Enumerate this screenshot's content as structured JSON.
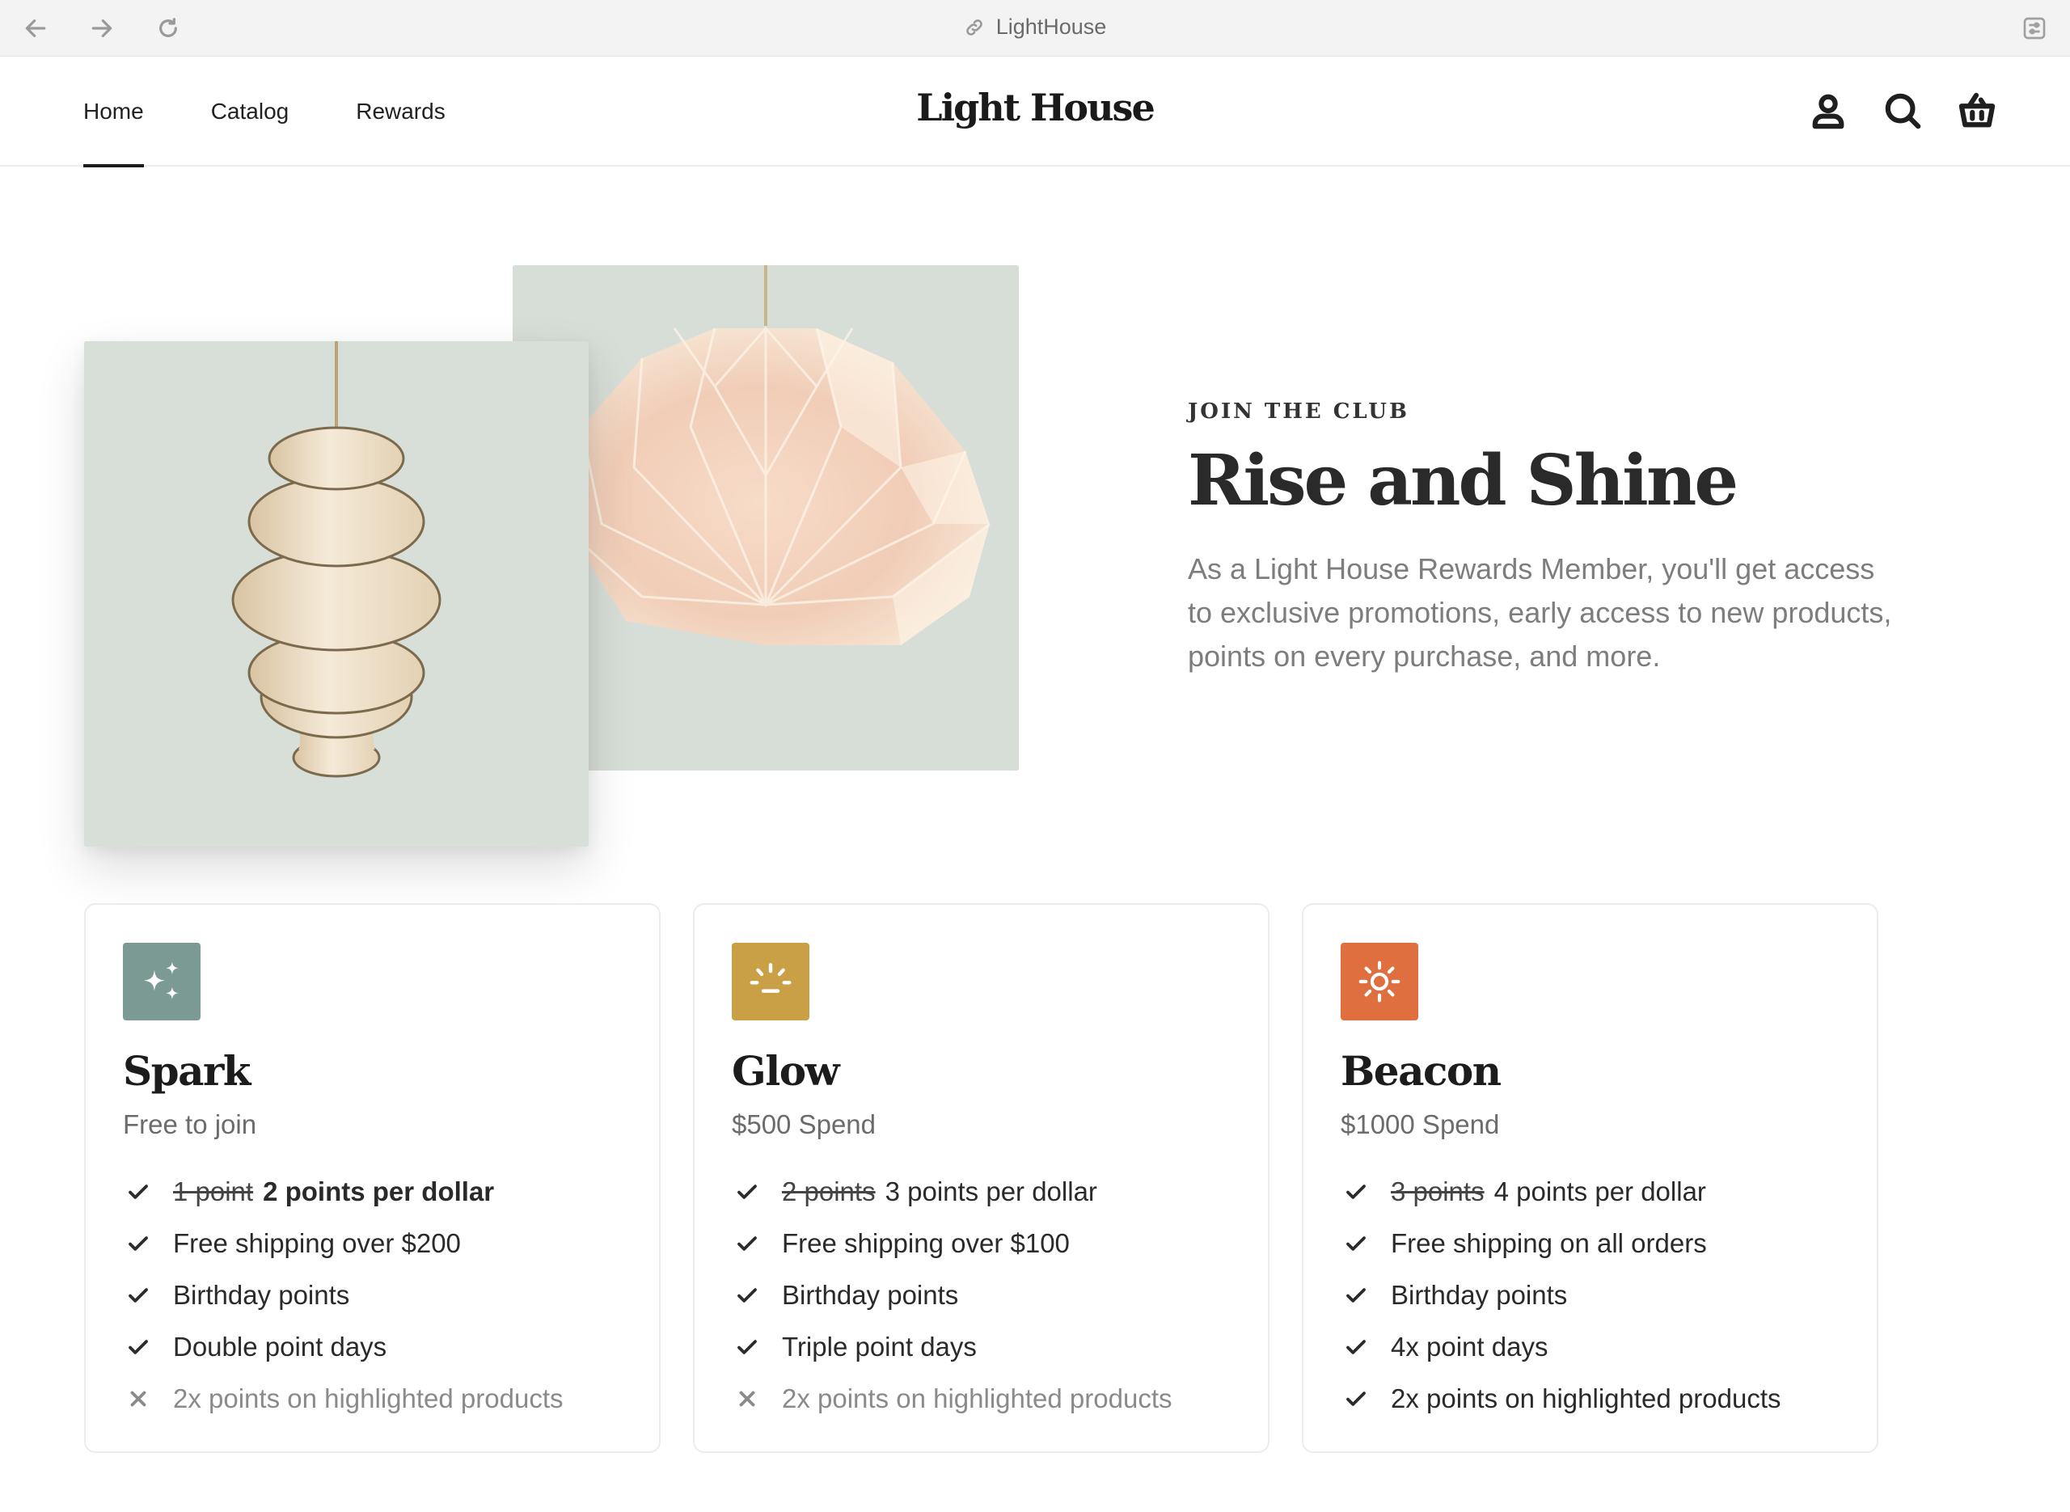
{
  "browser": {
    "url_title": "LightHouse",
    "back_icon": "arrow-left-icon",
    "forward_icon": "arrow-right-icon",
    "reload_icon": "reload-icon"
  },
  "header": {
    "nav": [
      {
        "label": "Home",
        "active": true
      },
      {
        "label": "Catalog",
        "active": false
      },
      {
        "label": "Rewards",
        "active": false
      }
    ],
    "logo": "Light House",
    "icons": [
      "account-icon",
      "search-icon",
      "cart-icon"
    ]
  },
  "hero": {
    "eyebrow": "JOIN THE CLUB",
    "title": "Rise and Shine",
    "description": "As a Light House Rewards Member, you'll get access to exclusive promotions, early access to new products, points on every purchase, and more."
  },
  "tiers": [
    {
      "name": "Spark",
      "subtitle": "Free to join",
      "icon": "sparkle-icon",
      "color": "#7a9a93",
      "perks": [
        {
          "strike": "1 point",
          "text": "2 points per dollar",
          "bold": true,
          "included": true
        },
        {
          "text": "Free shipping over $200",
          "included": true
        },
        {
          "text": "Birthday points",
          "included": true
        },
        {
          "text": "Double point days",
          "included": true
        },
        {
          "text": "2x points on highlighted products",
          "included": false
        }
      ]
    },
    {
      "name": "Glow",
      "subtitle": "$500 Spend",
      "icon": "sunrise-icon",
      "color": "#c9a045",
      "perks": [
        {
          "strike": "2 points",
          "text": "3 points per dollar",
          "bold": false,
          "included": true
        },
        {
          "text": "Free shipping over $100",
          "included": true
        },
        {
          "text": "Birthday points",
          "included": true
        },
        {
          "text": "Triple point days",
          "included": true
        },
        {
          "text": "2x points on highlighted products",
          "included": false
        }
      ]
    },
    {
      "name": "Beacon",
      "subtitle": "$1000 Spend",
      "icon": "sun-icon",
      "color": "#df6f3f",
      "perks": [
        {
          "strike": "3 points",
          "text": "4 points per dollar",
          "bold": false,
          "included": true
        },
        {
          "text": "Free shipping on all orders",
          "included": true
        },
        {
          "text": "Birthday points",
          "included": true
        },
        {
          "text": "4x point days",
          "included": true
        },
        {
          "text": "2x points on highlighted products",
          "included": true
        }
      ]
    }
  ]
}
